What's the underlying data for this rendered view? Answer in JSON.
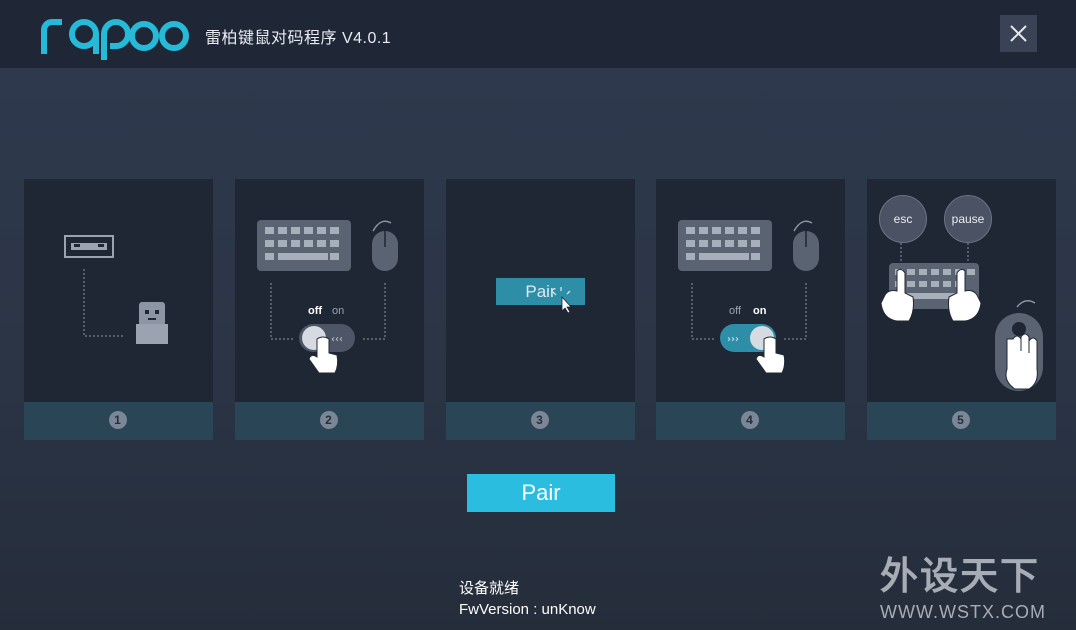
{
  "app": {
    "logo_text": "rapoo",
    "title": "雷柏键鼠对码程序 V4.0.1",
    "brand_color": "#27b9d8"
  },
  "window": {
    "close_icon": "close-icon"
  },
  "steps": [
    {
      "number": "1"
    },
    {
      "number": "2",
      "off_label": "off",
      "on_label": "on"
    },
    {
      "number": "3",
      "mini_button_label": "Pair"
    },
    {
      "number": "4",
      "off_label": "off",
      "on_label": "on"
    },
    {
      "number": "5",
      "key1": "esc",
      "key2": "pause"
    }
  ],
  "pair_button": {
    "label": "Pair",
    "color": "#2bbde0"
  },
  "status": {
    "line1": "设备就绪",
    "line2": "FwVersion : unKnow"
  },
  "watermark": {
    "text": "外设天下",
    "url": "WWW.WSTX.COM"
  }
}
